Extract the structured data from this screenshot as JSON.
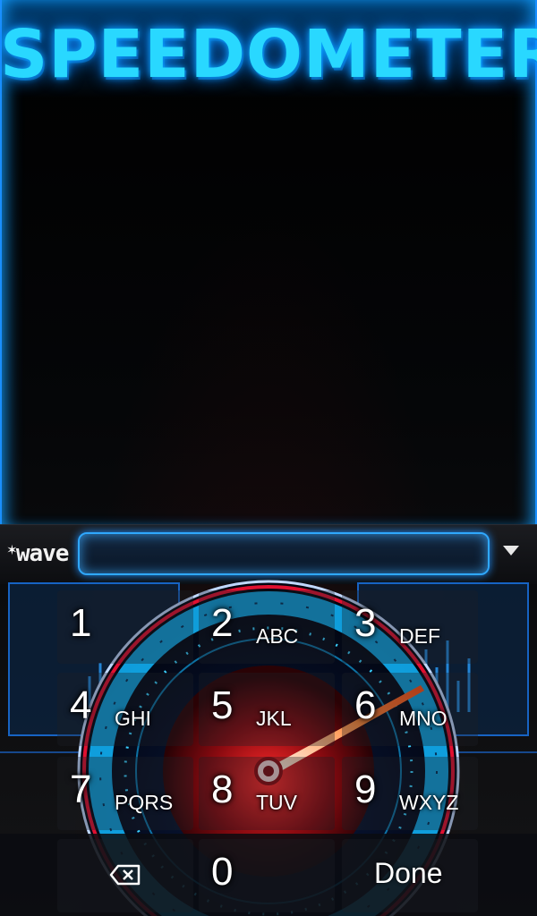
{
  "app": {
    "title": "SPEEDOMETER"
  },
  "input": {
    "logo_text": "wave",
    "value": ""
  },
  "keypad": {
    "keys": [
      {
        "digit": "1",
        "letters": ""
      },
      {
        "digit": "2",
        "letters": "ABC"
      },
      {
        "digit": "3",
        "letters": "DEF"
      },
      {
        "digit": "4",
        "letters": "GHI"
      },
      {
        "digit": "5",
        "letters": "JKL"
      },
      {
        "digit": "6",
        "letters": "MNO"
      },
      {
        "digit": "7",
        "letters": "PQRS"
      },
      {
        "digit": "8",
        "letters": "TUV"
      },
      {
        "digit": "9",
        "letters": "WXYZ"
      }
    ],
    "zero": "0",
    "done_label": "Done"
  },
  "colors": {
    "accent": "#29d8ff",
    "glow": "#1a8fff",
    "needle": "#ff6a2a",
    "hub": "#c8141c"
  }
}
